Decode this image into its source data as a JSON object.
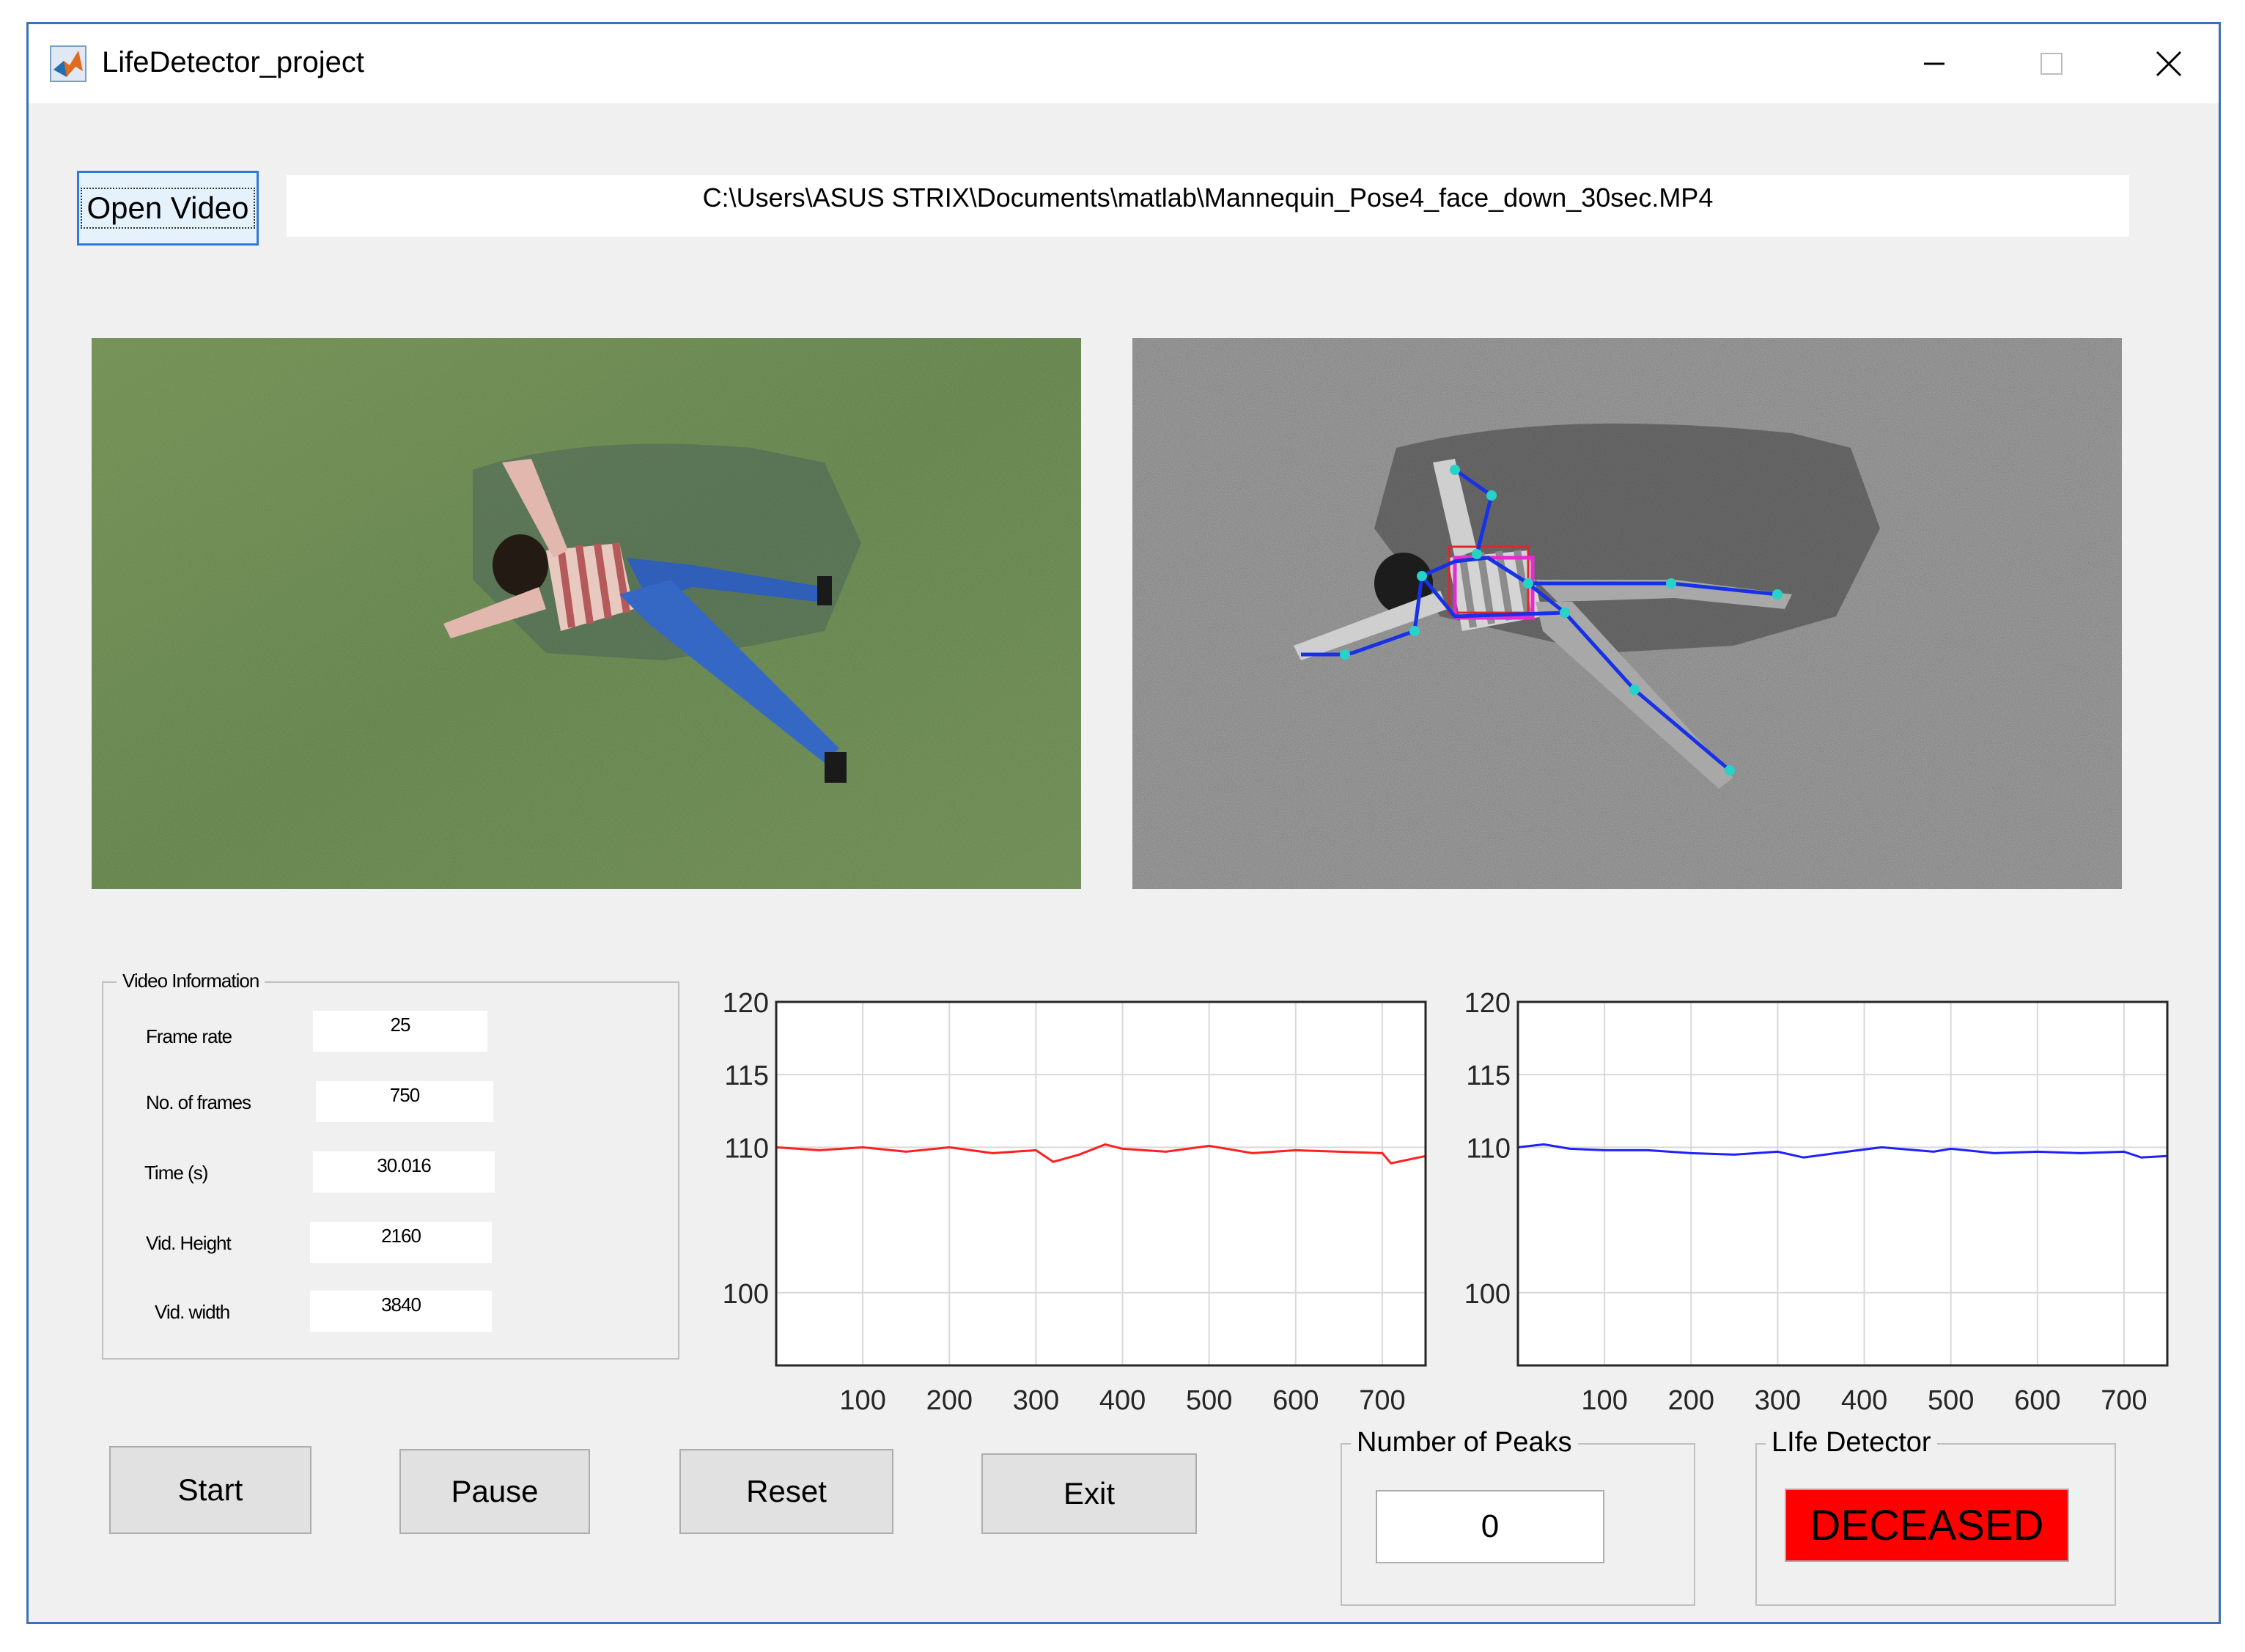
{
  "window": {
    "title": "LifeDetector_project",
    "icon": "matlab-icon",
    "controls": [
      "minimize-icon",
      "maximize-icon",
      "close-icon"
    ]
  },
  "file": {
    "open_label": "Open Video",
    "path": "C:\\Users\\ASUS STRIX\\Documents\\matlab\\Mannequin_Pose4_face_down_30sec.MP4"
  },
  "video_info": {
    "title": "Video Information",
    "fields": [
      {
        "label": "Frame rate",
        "value": "25"
      },
      {
        "label": "No. of frames",
        "value": "750"
      },
      {
        "label": "Time (s)",
        "value": "30.016"
      },
      {
        "label": "Vid. Height",
        "value": "2160"
      },
      {
        "label": "Vid. width",
        "value": "3840"
      }
    ]
  },
  "chart_data": [
    {
      "type": "line",
      "x_ticks": [
        100,
        200,
        300,
        400,
        500,
        600,
        700
      ],
      "y_ticks": [
        100,
        110,
        115,
        120
      ],
      "xlim": [
        0,
        750
      ],
      "ylim": [
        95,
        120
      ],
      "grid": true,
      "series": [
        {
          "color": "#ff2020",
          "x": [
            0,
            50,
            100,
            150,
            200,
            250,
            300,
            320,
            350,
            380,
            400,
            450,
            500,
            550,
            600,
            650,
            700,
            710,
            750
          ],
          "y": [
            110.0,
            109.8,
            110.0,
            109.7,
            110.0,
            109.6,
            109.8,
            109.0,
            109.5,
            110.2,
            109.9,
            109.7,
            110.1,
            109.6,
            109.8,
            109.7,
            109.6,
            108.9,
            109.4
          ]
        }
      ]
    },
    {
      "type": "line",
      "x_ticks": [
        100,
        200,
        300,
        400,
        500,
        600,
        700
      ],
      "y_ticks": [
        100,
        110,
        115,
        120
      ],
      "xlim": [
        0,
        750
      ],
      "ylim": [
        95,
        120
      ],
      "grid": true,
      "series": [
        {
          "color": "#2020ff",
          "x": [
            0,
            30,
            60,
            100,
            150,
            200,
            250,
            300,
            330,
            380,
            420,
            480,
            500,
            550,
            600,
            650,
            700,
            720,
            750
          ],
          "y": [
            110.0,
            110.2,
            109.9,
            109.8,
            109.8,
            109.6,
            109.5,
            109.7,
            109.3,
            109.7,
            110.0,
            109.7,
            109.9,
            109.6,
            109.7,
            109.6,
            109.7,
            109.3,
            109.4
          ]
        }
      ]
    }
  ],
  "controls": {
    "start": "Start",
    "pause": "Pause",
    "reset": "Reset",
    "exit": "Exit"
  },
  "peaks": {
    "title": "Number of Peaks",
    "value": "0"
  },
  "life": {
    "title": "LIfe Detector",
    "status": "DECEASED",
    "status_color": "#ff0000"
  }
}
